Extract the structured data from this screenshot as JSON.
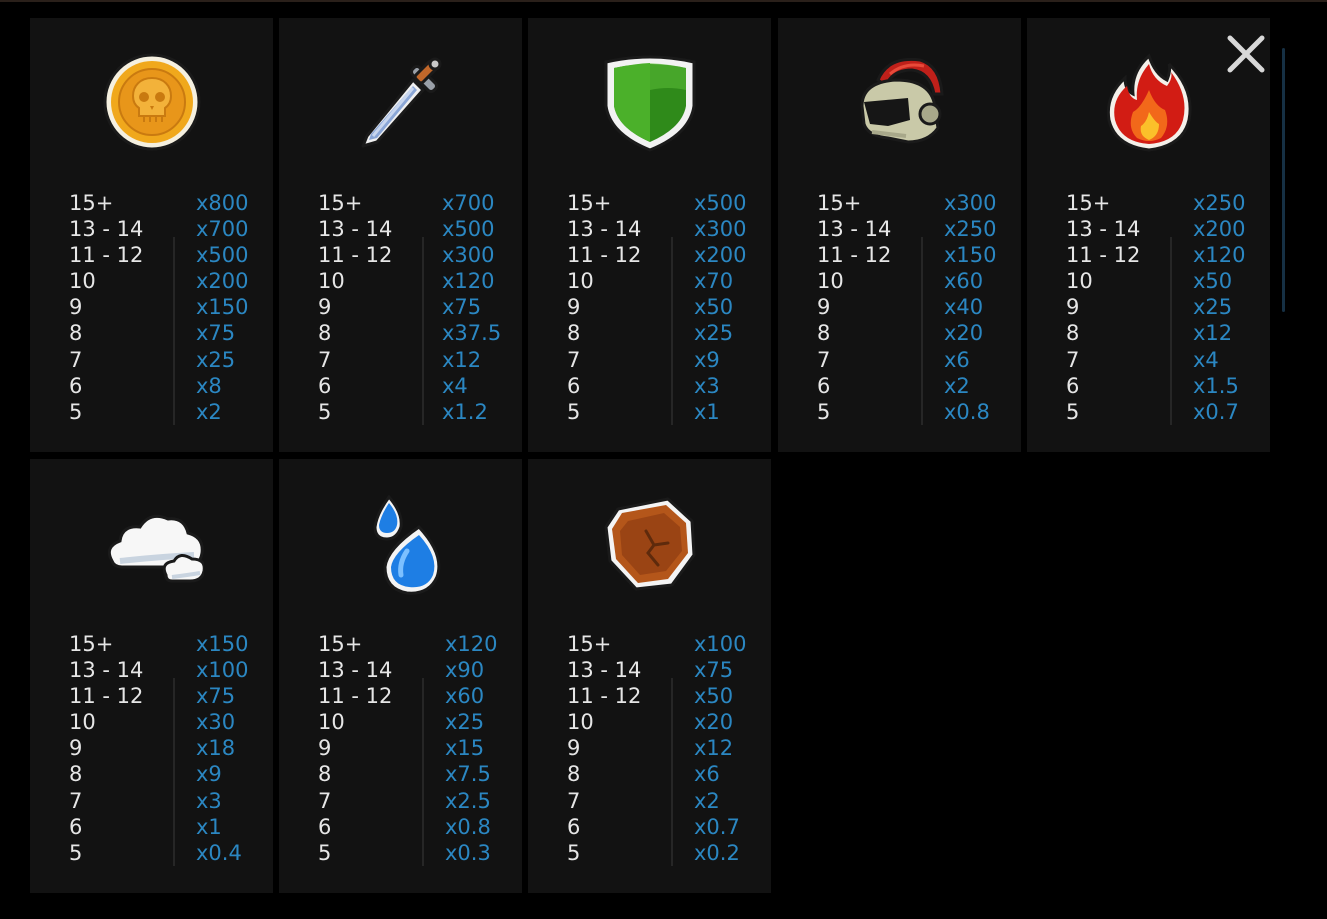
{
  "paytable": {
    "cards": [
      {
        "icon": "gold-skull-coin-icon",
        "rows": [
          {
            "count": "15+",
            "multiplier": "x800"
          },
          {
            "count": "13 - 14",
            "multiplier": "x700"
          },
          {
            "count": "11 - 12",
            "multiplier": "x500"
          },
          {
            "count": "10",
            "multiplier": "x200"
          },
          {
            "count": "9",
            "multiplier": "x150"
          },
          {
            "count": "8",
            "multiplier": "x75"
          },
          {
            "count": "7",
            "multiplier": "x25"
          },
          {
            "count": "6",
            "multiplier": "x8"
          },
          {
            "count": "5",
            "multiplier": "x2"
          }
        ]
      },
      {
        "icon": "sword-icon",
        "rows": [
          {
            "count": "15+",
            "multiplier": "x700"
          },
          {
            "count": "13 - 14",
            "multiplier": "x500"
          },
          {
            "count": "11 - 12",
            "multiplier": "x300"
          },
          {
            "count": "10",
            "multiplier": "x120"
          },
          {
            "count": "9",
            "multiplier": "x75"
          },
          {
            "count": "8",
            "multiplier": "x37.5"
          },
          {
            "count": "7",
            "multiplier": "x12"
          },
          {
            "count": "6",
            "multiplier": "x4"
          },
          {
            "count": "5",
            "multiplier": "x1.2"
          }
        ]
      },
      {
        "icon": "green-shield-icon",
        "rows": [
          {
            "count": "15+",
            "multiplier": "x500"
          },
          {
            "count": "13 - 14",
            "multiplier": "x300"
          },
          {
            "count": "11 - 12",
            "multiplier": "x200"
          },
          {
            "count": "10",
            "multiplier": "x70"
          },
          {
            "count": "9",
            "multiplier": "x50"
          },
          {
            "count": "8",
            "multiplier": "x25"
          },
          {
            "count": "7",
            "multiplier": "x9"
          },
          {
            "count": "6",
            "multiplier": "x3"
          },
          {
            "count": "5",
            "multiplier": "x1"
          }
        ]
      },
      {
        "icon": "roman-helmet-icon",
        "rows": [
          {
            "count": "15+",
            "multiplier": "x300"
          },
          {
            "count": "13 - 14",
            "multiplier": "x250"
          },
          {
            "count": "11 - 12",
            "multiplier": "x150"
          },
          {
            "count": "10",
            "multiplier": "x60"
          },
          {
            "count": "9",
            "multiplier": "x40"
          },
          {
            "count": "8",
            "multiplier": "x20"
          },
          {
            "count": "7",
            "multiplier": "x6"
          },
          {
            "count": "6",
            "multiplier": "x2"
          },
          {
            "count": "5",
            "multiplier": "x0.8"
          }
        ]
      },
      {
        "icon": "fire-icon",
        "rows": [
          {
            "count": "15+",
            "multiplier": "x250"
          },
          {
            "count": "13 - 14",
            "multiplier": "x200"
          },
          {
            "count": "11 - 12",
            "multiplier": "x120"
          },
          {
            "count": "10",
            "multiplier": "x50"
          },
          {
            "count": "9",
            "multiplier": "x25"
          },
          {
            "count": "8",
            "multiplier": "x12"
          },
          {
            "count": "7",
            "multiplier": "x4"
          },
          {
            "count": "6",
            "multiplier": "x1.5"
          },
          {
            "count": "5",
            "multiplier": "x0.7"
          }
        ]
      },
      {
        "icon": "cloud-icon",
        "rows": [
          {
            "count": "15+",
            "multiplier": "x150"
          },
          {
            "count": "13 - 14",
            "multiplier": "x100"
          },
          {
            "count": "11 - 12",
            "multiplier": "x75"
          },
          {
            "count": "10",
            "multiplier": "x30"
          },
          {
            "count": "9",
            "multiplier": "x18"
          },
          {
            "count": "8",
            "multiplier": "x9"
          },
          {
            "count": "7",
            "multiplier": "x3"
          },
          {
            "count": "6",
            "multiplier": "x1"
          },
          {
            "count": "5",
            "multiplier": "x0.4"
          }
        ]
      },
      {
        "icon": "water-drop-icon",
        "rows": [
          {
            "count": "15+",
            "multiplier": "x120"
          },
          {
            "count": "13 - 14",
            "multiplier": "x90"
          },
          {
            "count": "11 - 12",
            "multiplier": "x60"
          },
          {
            "count": "10",
            "multiplier": "x25"
          },
          {
            "count": "9",
            "multiplier": "x15"
          },
          {
            "count": "8",
            "multiplier": "x7.5"
          },
          {
            "count": "7",
            "multiplier": "x2.5"
          },
          {
            "count": "6",
            "multiplier": "x0.8"
          },
          {
            "count": "5",
            "multiplier": "x0.3"
          }
        ]
      },
      {
        "icon": "rock-icon",
        "rows": [
          {
            "count": "15+",
            "multiplier": "x100"
          },
          {
            "count": "13 - 14",
            "multiplier": "x75"
          },
          {
            "count": "11 - 12",
            "multiplier": "x50"
          },
          {
            "count": "10",
            "multiplier": "x20"
          },
          {
            "count": "9",
            "multiplier": "x12"
          },
          {
            "count": "8",
            "multiplier": "x6"
          },
          {
            "count": "7",
            "multiplier": "x2"
          },
          {
            "count": "6",
            "multiplier": "x0.7"
          },
          {
            "count": "5",
            "multiplier": "x0.2"
          }
        ]
      }
    ]
  },
  "close_icon": "close-icon",
  "colors": {
    "background": "#000000",
    "card": "#121212",
    "count_text": "#e6e6e6",
    "multiplier_text": "#2b87c2"
  }
}
